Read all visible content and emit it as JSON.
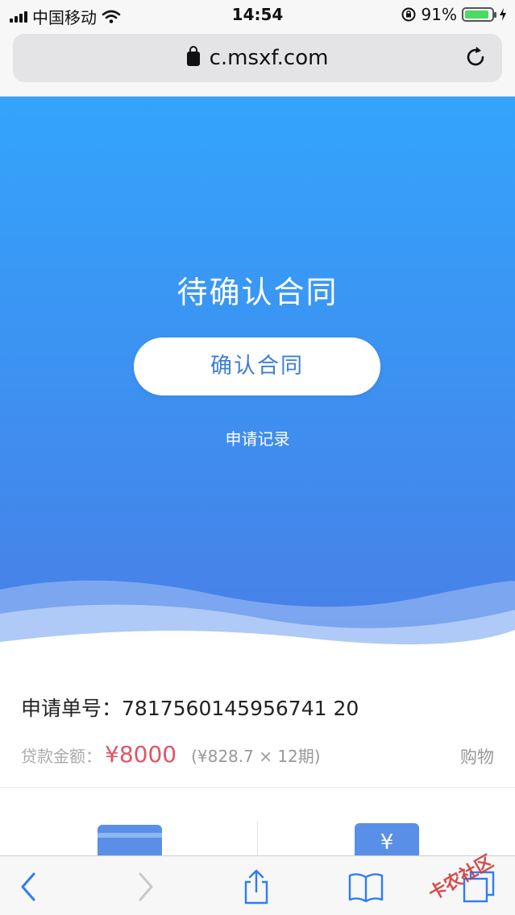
{
  "status_bar": {
    "carrier": "中国移动",
    "time": "14:54",
    "battery": "91%",
    "battery_level": 0.91
  },
  "browser": {
    "url": "c.msxf.com"
  },
  "hero": {
    "title": "待确认合同",
    "confirm_button": "确认合同",
    "records_link": "申请记录"
  },
  "application": {
    "order_label": "申请单号：",
    "order_number": "7817560145956741 20",
    "amount_label": "贷款金额：",
    "amount": "¥8000",
    "installment": "(¥828.7 × 12期)",
    "purpose": "购物"
  },
  "lower": {
    "coupon_symbol": "¥"
  },
  "watermark": "卡农社区",
  "colors": {
    "hero_top": "#33a4fb",
    "hero_bottom": "#4a7ee6",
    "amount": "#e05564",
    "button_text": "#3d7fd8",
    "toolbar_icon": "#2f7cf6"
  }
}
